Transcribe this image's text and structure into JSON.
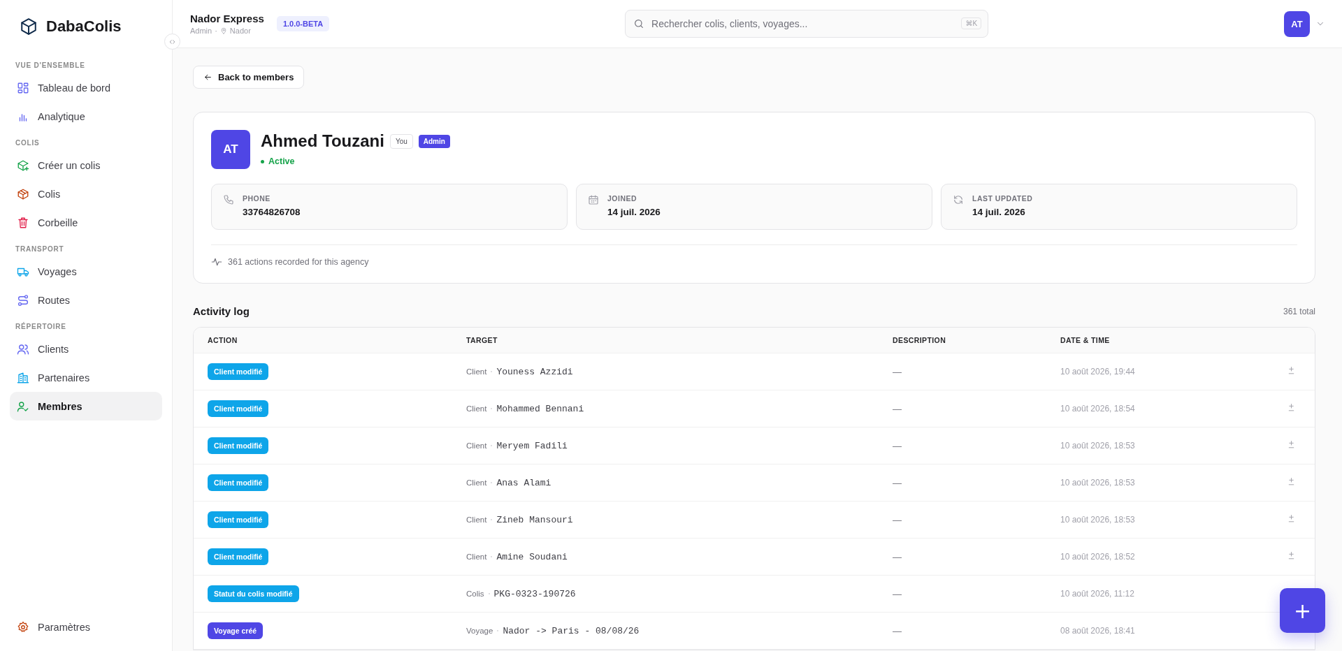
{
  "brand": {
    "name": "DabaColis"
  },
  "sidebar": {
    "sections": [
      {
        "label": "VUE D'ENSEMBLE",
        "items": [
          {
            "label": "Tableau de bord",
            "selected": false
          },
          {
            "label": "Analytique",
            "selected": false
          }
        ]
      },
      {
        "label": "COLIS",
        "items": [
          {
            "label": "Créer un colis",
            "selected": false
          },
          {
            "label": "Colis",
            "selected": false
          },
          {
            "label": "Corbeille",
            "selected": false
          }
        ]
      },
      {
        "label": "TRANSPORT",
        "items": [
          {
            "label": "Voyages",
            "selected": false
          },
          {
            "label": "Routes",
            "selected": false
          }
        ]
      },
      {
        "label": "RÉPERTOIRE",
        "items": [
          {
            "label": "Clients",
            "selected": false
          },
          {
            "label": "Partenaires",
            "selected": false
          },
          {
            "label": "Membres",
            "selected": true
          }
        ]
      }
    ],
    "footer_item": {
      "label": "Paramètres",
      "selected": false
    }
  },
  "topbar": {
    "agency": "Nador Express",
    "role": "Admin",
    "separator": "·",
    "city": "Nador",
    "version": "1.0.0-BETA",
    "search": {
      "placeholder": "Rechercher colis, clients, voyages...",
      "shortcut": "⌘K"
    },
    "avatar": "AT"
  },
  "back_button": "Back to members",
  "profile": {
    "initials": "AT",
    "name": "Ahmed Touzani",
    "you_badge": "You",
    "role_badge": "Admin",
    "status": "Active",
    "active": true,
    "info": [
      {
        "kind": "phone",
        "label": "PHONE",
        "value": "33764826708"
      },
      {
        "kind": "calendar",
        "label": "JOINED",
        "value": "14 juil. 2026"
      },
      {
        "kind": "refresh",
        "label": "LAST UPDATED",
        "value": "14 juil. 2026"
      }
    ],
    "summary": "361 actions recorded for this agency"
  },
  "activity": {
    "title": "Activity log",
    "total": "361 total",
    "columns": [
      "ACTION",
      "TARGET",
      "DESCRIPTION",
      "DATE & TIME"
    ],
    "rows": [
      {
        "action": "Client modifié",
        "color": "#0ea5e9",
        "target_type": "Client",
        "target": "Youness Azzidi",
        "description": "—",
        "date": "10 août 2026, 19:44",
        "toggle": true
      },
      {
        "action": "Client modifié",
        "color": "#0ea5e9",
        "target_type": "Client",
        "target": "Mohammed Bennani",
        "description": "—",
        "date": "10 août 2026, 18:54",
        "toggle": true
      },
      {
        "action": "Client modifié",
        "color": "#0ea5e9",
        "target_type": "Client",
        "target": "Meryem Fadili",
        "description": "—",
        "date": "10 août 2026, 18:53",
        "toggle": true
      },
      {
        "action": "Client modifié",
        "color": "#0ea5e9",
        "target_type": "Client",
        "target": "Anas Alami",
        "description": "—",
        "date": "10 août 2026, 18:53",
        "toggle": true
      },
      {
        "action": "Client modifié",
        "color": "#0ea5e9",
        "target_type": "Client",
        "target": "Zineb Mansouri",
        "description": "—",
        "date": "10 août 2026, 18:53",
        "toggle": true
      },
      {
        "action": "Client modifié",
        "color": "#0ea5e9",
        "target_type": "Client",
        "target": "Amine Soudani",
        "description": "—",
        "date": "10 août 2026, 18:52",
        "toggle": true
      },
      {
        "action": "Statut du colis modifié",
        "color": "#0ea5e9",
        "target_type": "Colis",
        "target": "PKG-0323-190726",
        "description": "—",
        "date": "10 août 2026, 11:12",
        "toggle": false
      },
      {
        "action": "Voyage créé",
        "color": "#4f46e5",
        "target_type": "Voyage",
        "target": "Nador -> Paris - 08/08/26",
        "description": "—",
        "date": "08 août 2026, 18:41",
        "toggle": false
      }
    ]
  },
  "fab": "+"
}
